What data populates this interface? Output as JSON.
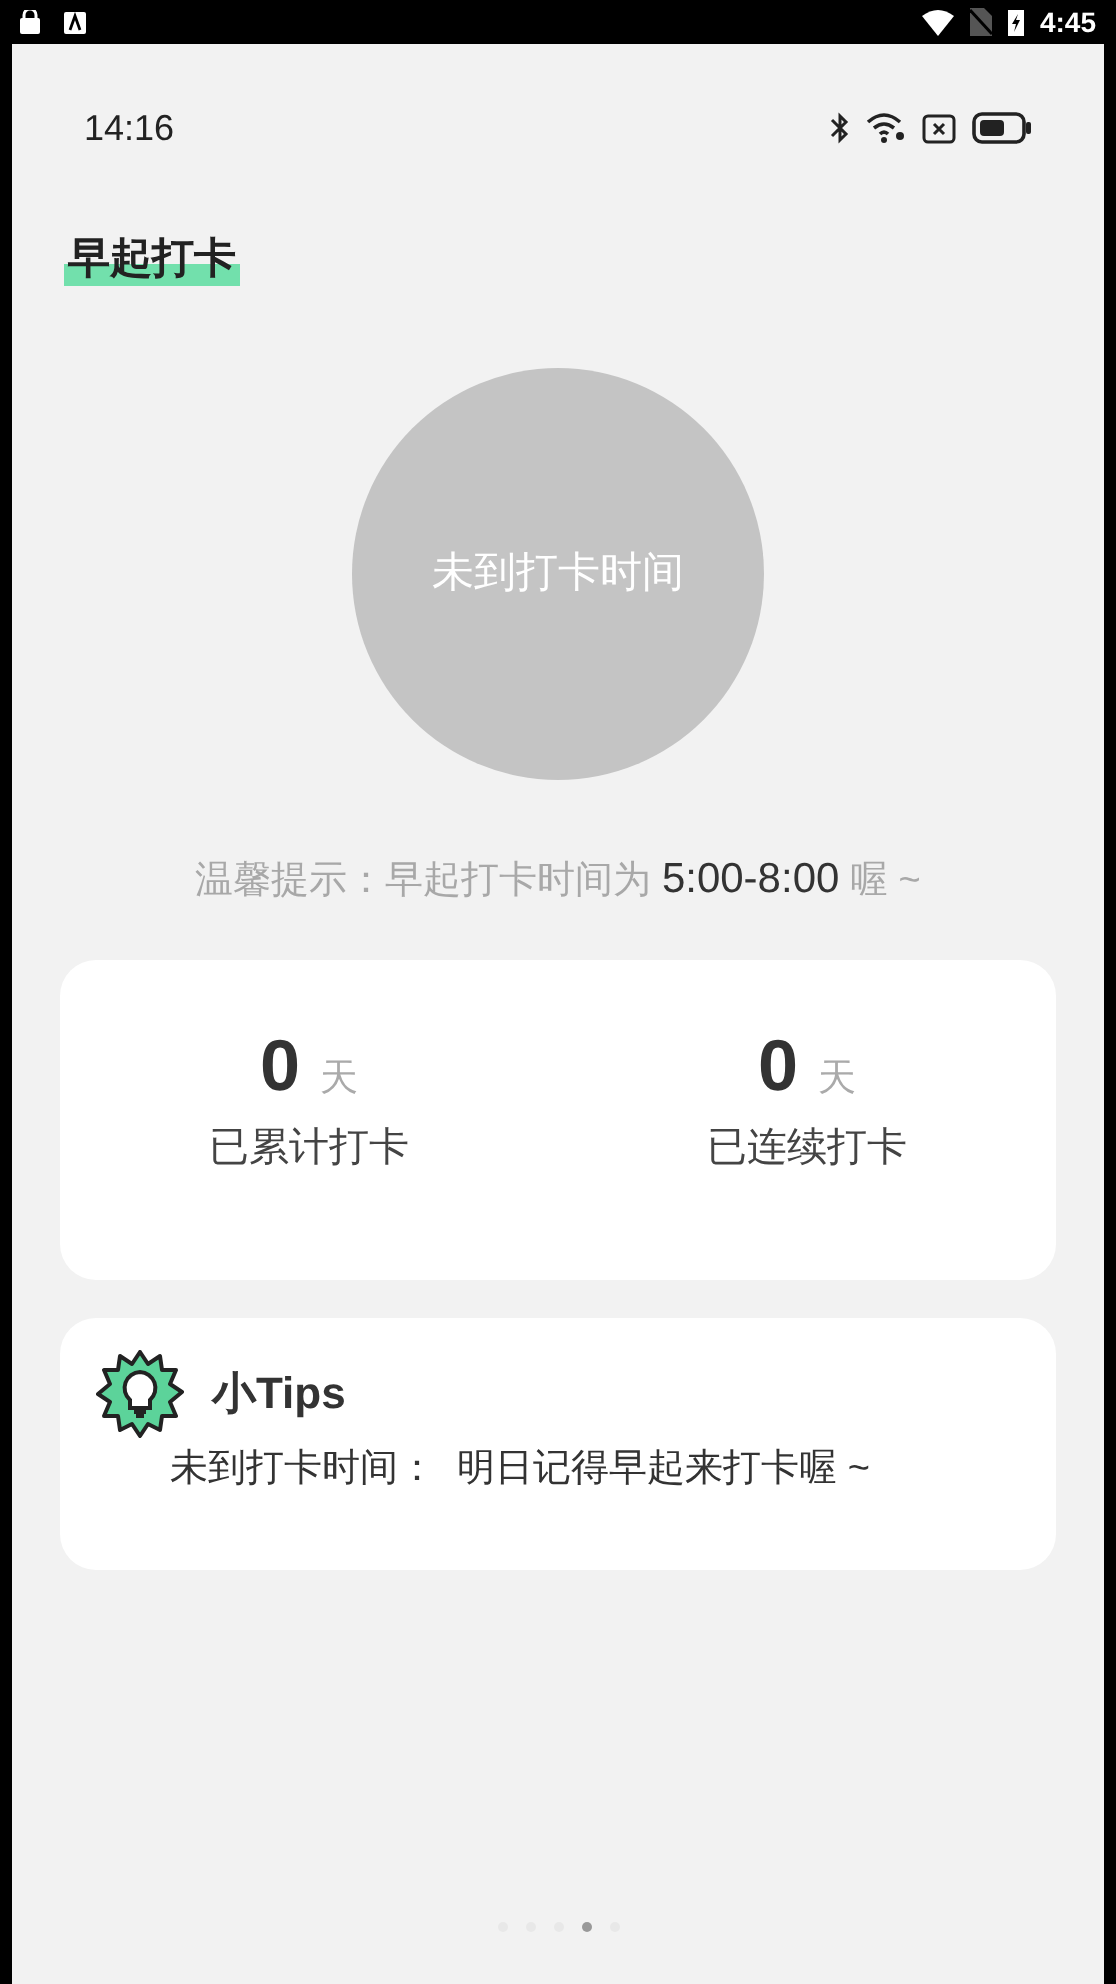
{
  "system_bar": {
    "time": "4:45"
  },
  "status_bar": {
    "time": "14:16"
  },
  "title": "早起打卡",
  "checkin_button": {
    "label": "未到打卡时间",
    "disabled": true
  },
  "hint": {
    "prefix": "温馨提示：早起打卡时间为",
    "time_range": "5:00-8:00",
    "suffix": "喔 ~"
  },
  "stats": [
    {
      "value": "0",
      "unit": "天",
      "label": "已累计打卡"
    },
    {
      "value": "0",
      "unit": "天",
      "label": "已连续打卡"
    }
  ],
  "tips": {
    "title": "小Tips",
    "message": "未到打卡时间：  明日记得早起来打卡喔 ~"
  },
  "pages": [
    {
      "selected": false
    },
    {
      "selected": false
    },
    {
      "selected": false
    },
    {
      "selected": true
    },
    {
      "selected": false
    }
  ]
}
